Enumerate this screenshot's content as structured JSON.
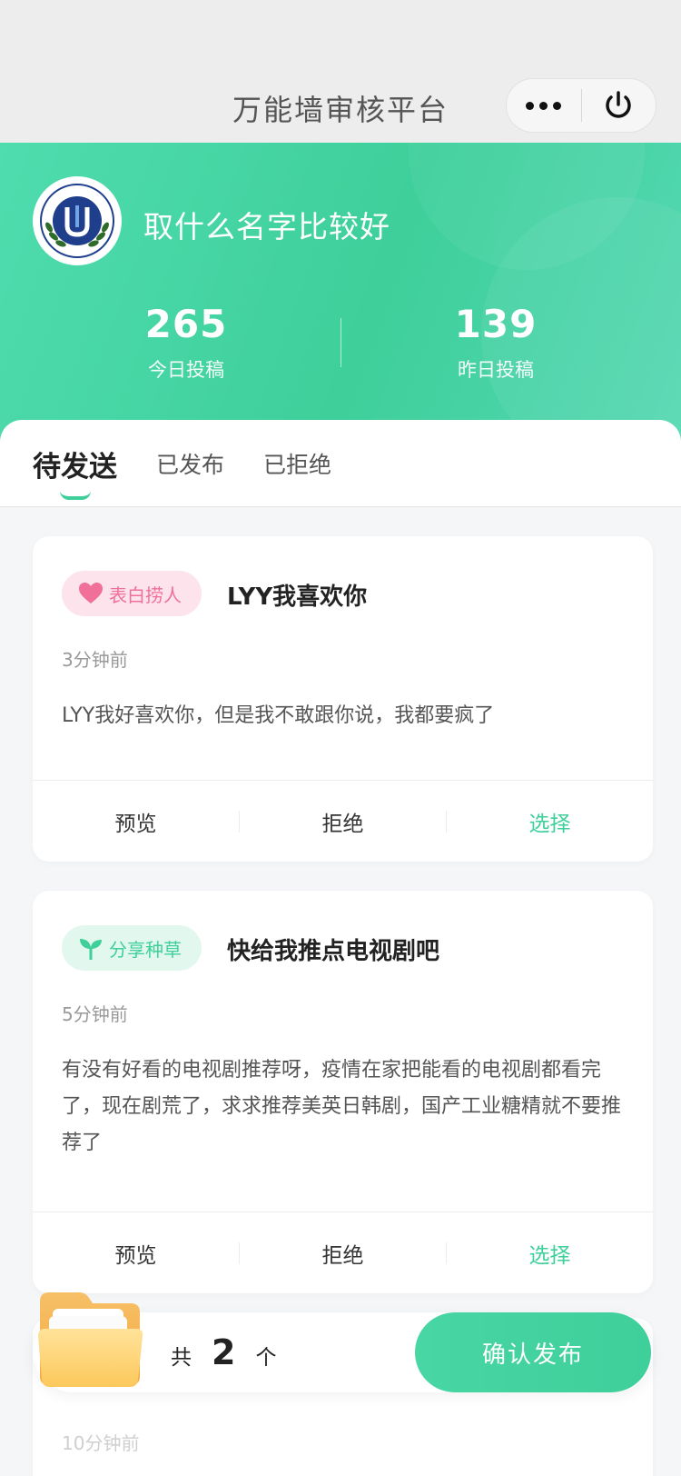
{
  "navbar": {
    "title": "万能墙审核平台"
  },
  "header": {
    "org_name": "取什么名字比较好",
    "stats": [
      {
        "value": "265",
        "label": "今日投稿"
      },
      {
        "value": "139",
        "label": "昨日投稿"
      }
    ]
  },
  "tabs": [
    {
      "label": "待发送",
      "active": true
    },
    {
      "label": "已发布",
      "active": false
    },
    {
      "label": "已拒绝",
      "active": false
    }
  ],
  "posts": [
    {
      "tag": "表白捞人",
      "tag_icon": "heart-icon",
      "tag_color": "#f0709a",
      "title": "LYY我喜欢你",
      "time": "3分钟前",
      "content": "LYY我好喜欢你，但是我不敢跟你说，我都要疯了",
      "actions": {
        "preview": "预览",
        "reject": "拒绝",
        "select": "选择"
      }
    },
    {
      "tag": "分享种草",
      "tag_icon": "sprout-icon",
      "tag_color": "#3ecf9b",
      "title": "快给我推点电视剧吧",
      "time": "5分钟前",
      "content": "有没有好看的电视剧推荐呀，疫情在家把能看的电视剧都看完了，现在剧荒了，求求推荐美英日韩剧，国产工业糖精就不要推荐了",
      "actions": {
        "preview": "预览",
        "reject": "拒绝",
        "select": "选择"
      }
    },
    {
      "time": "10分钟前"
    }
  ],
  "bottom_bar": {
    "prefix": "共",
    "count": "2",
    "suffix": "个",
    "confirm_label": "确认发布"
  },
  "colors": {
    "accent": "#3ecf9b",
    "header_gradient_start": "#4fdcae",
    "pink_tag": "#f0709a"
  }
}
